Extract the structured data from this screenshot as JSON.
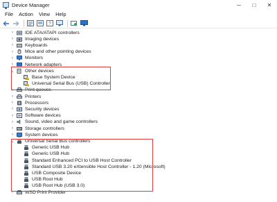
{
  "window": {
    "title": "Device Manager"
  },
  "window_controls": {
    "minimize": "─",
    "maximize": "□",
    "close": "✕"
  },
  "menu": [
    {
      "label": "File"
    },
    {
      "label": "Action"
    },
    {
      "label": "View"
    },
    {
      "label": "Help"
    }
  ],
  "tree": [
    {
      "label": "IDE ATA/ATAPI controllers",
      "icon": "ide-controller-icon",
      "level": 1,
      "expander": "›"
    },
    {
      "label": "Imaging devices",
      "icon": "camera-icon",
      "level": 1,
      "expander": "›"
    },
    {
      "label": "Keyboards",
      "icon": "keyboard-icon",
      "level": 1,
      "expander": "›"
    },
    {
      "label": "Mice and other pointing devices",
      "icon": "mouse-icon",
      "level": 1,
      "expander": "›"
    },
    {
      "label": "Monitors",
      "icon": "monitor-icon",
      "level": 1,
      "expander": "›"
    },
    {
      "label": "Network adapters",
      "icon": "network-adapter-icon",
      "level": 1,
      "expander": "›"
    },
    {
      "label": "Other devices",
      "icon": "unknown-device-icon",
      "level": 1,
      "expander": "⌄"
    },
    {
      "label": "Base System Device",
      "icon": "warning-device-icon",
      "level": 2,
      "expander": ""
    },
    {
      "label": "Universal Serial Bus (USB) Controller",
      "icon": "warning-device-icon",
      "level": 2,
      "expander": ""
    },
    {
      "label": "Print queues",
      "icon": "printer-icon",
      "level": 1,
      "expander": "›"
    },
    {
      "label": "Printers",
      "icon": "printer-icon",
      "level": 1,
      "expander": "›"
    },
    {
      "label": "Processors",
      "icon": "cpu-icon",
      "level": 1,
      "expander": "›"
    },
    {
      "label": "Security devices",
      "icon": "security-device-icon",
      "level": 1,
      "expander": "›"
    },
    {
      "label": "Software devices",
      "icon": "software-device-icon",
      "level": 1,
      "expander": "›"
    },
    {
      "label": "Sound, video and game controllers",
      "icon": "speaker-icon",
      "level": 1,
      "expander": "›"
    },
    {
      "label": "Storage controllers",
      "icon": "storage-icon",
      "level": 1,
      "expander": "›"
    },
    {
      "label": "System devices",
      "icon": "system-device-icon",
      "level": 1,
      "expander": "›"
    },
    {
      "label": "Universal Serial Bus controllers",
      "icon": "usb-icon",
      "level": 1,
      "expander": "⌄"
    },
    {
      "label": "Generic USB Hub",
      "icon": "usb-icon",
      "level": 2,
      "expander": ""
    },
    {
      "label": "Generic USB Hub",
      "icon": "usb-icon",
      "level": 2,
      "expander": ""
    },
    {
      "label": "Standard Enhanced PCI to USB Host Controller",
      "icon": "usb-icon",
      "level": 2,
      "expander": ""
    },
    {
      "label": "Standard USB 3.20 eXtensible Host Controller - 1.20 (Microsoft)",
      "icon": "usb-icon",
      "level": 2,
      "expander": ""
    },
    {
      "label": "USB Composite Device",
      "icon": "usb-icon",
      "level": 2,
      "expander": ""
    },
    {
      "label": "USB Root Hub",
      "icon": "usb-icon",
      "level": 2,
      "expander": ""
    },
    {
      "label": "USB Root Hub (USB 3.0)",
      "icon": "usb-icon",
      "level": 2,
      "expander": ""
    },
    {
      "label": "WSD Print Provider",
      "icon": "printer-icon",
      "level": 1,
      "expander": "›"
    }
  ],
  "colors": {
    "highlight": "#e23b3b",
    "toolbar_blue": "#2f6fc4",
    "warning": "#e6b400"
  }
}
